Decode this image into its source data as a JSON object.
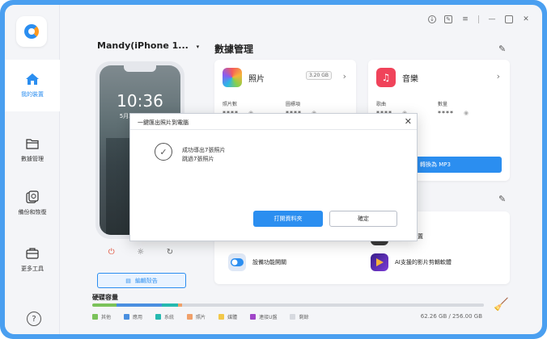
{
  "window": {
    "controls": [
      "download-icon",
      "feedback-icon",
      "menu-icon",
      "minimize-icon",
      "maximize-icon",
      "close-icon"
    ]
  },
  "sidebar": {
    "items": [
      {
        "label": "我的裝置",
        "icon": "home-icon",
        "active": true
      },
      {
        "label": "數據管理",
        "icon": "folder-icon",
        "active": false
      },
      {
        "label": "備份和恢復",
        "icon": "backup-icon",
        "active": false
      },
      {
        "label": "更多工具",
        "icon": "toolbox-icon",
        "active": false
      }
    ],
    "help": "?"
  },
  "device": {
    "name": "Mandy(iPhone 1...",
    "lock_time": "10:36",
    "lock_date": "5月30日 星期四",
    "edit_label": "編輯殼告"
  },
  "storage": {
    "title": "硬碟容量",
    "used": "62.26 GB / 256.00 GB",
    "segments": [
      {
        "name": "其他",
        "color": "#7bc25a",
        "fraction": 0.062
      },
      {
        "name": "應用",
        "color": "#4a8fe0",
        "fraction": 0.116
      },
      {
        "name": "系統",
        "color": "#25b9b0",
        "fraction": 0.04
      },
      {
        "name": "照片",
        "color": "#f0a06a",
        "fraction": 0.012
      },
      {
        "name": "媒體",
        "color": "#f2c84a",
        "fraction": 0.0
      },
      {
        "name": "連接U盤",
        "color": "#a045c8",
        "fraction": 0.0
      },
      {
        "name": "剩餘",
        "color": "#d6d9df",
        "fraction": 0.77
      }
    ]
  },
  "data_management": {
    "title": "數據管理",
    "photos": {
      "title": "照片",
      "size": "3.20 GB",
      "stat1_label": "照片數",
      "stat1_value": "****",
      "stat2_label": "圖標項",
      "stat2_value": "****"
    },
    "music": {
      "title": "音樂",
      "stat1_label": "歌曲",
      "stat1_value": "****",
      "stat2_label": "數量",
      "stat2_value": "****",
      "convert_label": "轉換為 MP3"
    }
  },
  "tools": {
    "items": [
      {
        "label": "設備功能開關",
        "icon": "toggle-icon"
      },
      {
        "label": "AI支援的影片剪輯軟體",
        "icon": "video-editor-icon"
      },
      {
        "label": "傳輸到裝置",
        "icon": "transfer-icon"
      }
    ]
  },
  "modal": {
    "title": "一鍵匯出照片到電腦",
    "line1": "成功導出7張照片",
    "line2": "跳過7張照片",
    "open_folder": "打開資料夾",
    "ok": "確定"
  },
  "colors": {
    "accent": "#2b8ef0",
    "frame": "#4a9ff0"
  }
}
